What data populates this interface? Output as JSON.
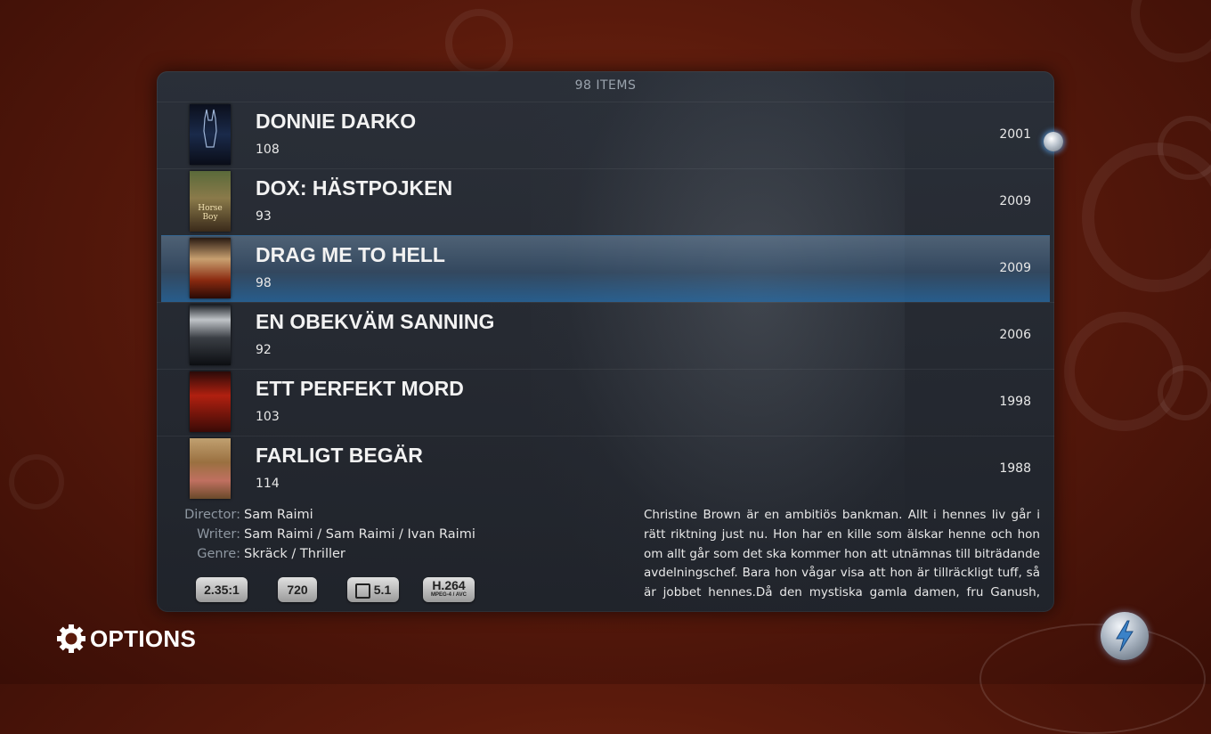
{
  "list": {
    "count_label": "98 ITEMS",
    "items": [
      {
        "title": "DONNIE DARKO",
        "runtime": "108",
        "year": "2001",
        "poster": "poster-donnie-darko"
      },
      {
        "title": "DOX: HÄSTPOJKEN",
        "runtime": "93",
        "year": "2009",
        "poster": "poster-dox-hastpojken"
      },
      {
        "title": "DRAG ME TO HELL",
        "runtime": "98",
        "year": "2009",
        "poster": "poster-drag-me-to-hell",
        "selected": true
      },
      {
        "title": "EN OBEKVÄM SANNING",
        "runtime": "92",
        "year": "2006",
        "poster": "poster-en-obekvam-sanning"
      },
      {
        "title": "ETT PERFEKT MORD",
        "runtime": "103",
        "year": "1998",
        "poster": "poster-ett-perfekt-mord"
      },
      {
        "title": "FARLIGT BEGÄR",
        "runtime": "114",
        "year": "1988",
        "poster": "poster-farligt-begar"
      }
    ]
  },
  "details": {
    "director_label": "Director:",
    "director": "Sam Raimi",
    "writer_label": "Writer:",
    "writer": "Sam Raimi / Sam Raimi / Ivan Raimi",
    "genre_label": "Genre:",
    "genre": "Skräck / Thriller",
    "badges": {
      "aspect": "2.35:1",
      "resolution": "720",
      "audio": "5.1",
      "codec": "H.264",
      "codec_sub": "MPEG-4 / AVC"
    },
    "plot": "Christine Brown är en ambitiös bankman. Allt i hennes liv går i rätt riktning just nu. Hon har en kille som älskar henne och hon om allt går som det ska kommer hon att utnämnas till biträdande avdelningschef. Bara hon vågar visa att hon är tillräckligt tuff, så är jobbet hennes.Då den mystiska gamla damen, fru Ganush, uppsöker"
  },
  "footer": {
    "options_label": "OPTIONS",
    "options_icon": "gear-icon",
    "power_icon": "lightning-power-icon"
  },
  "colors": {
    "background": "#5a1a0c",
    "panel": "#28303a",
    "selection": "#3c6e9a",
    "accent_glow": "#5aa0e6"
  }
}
